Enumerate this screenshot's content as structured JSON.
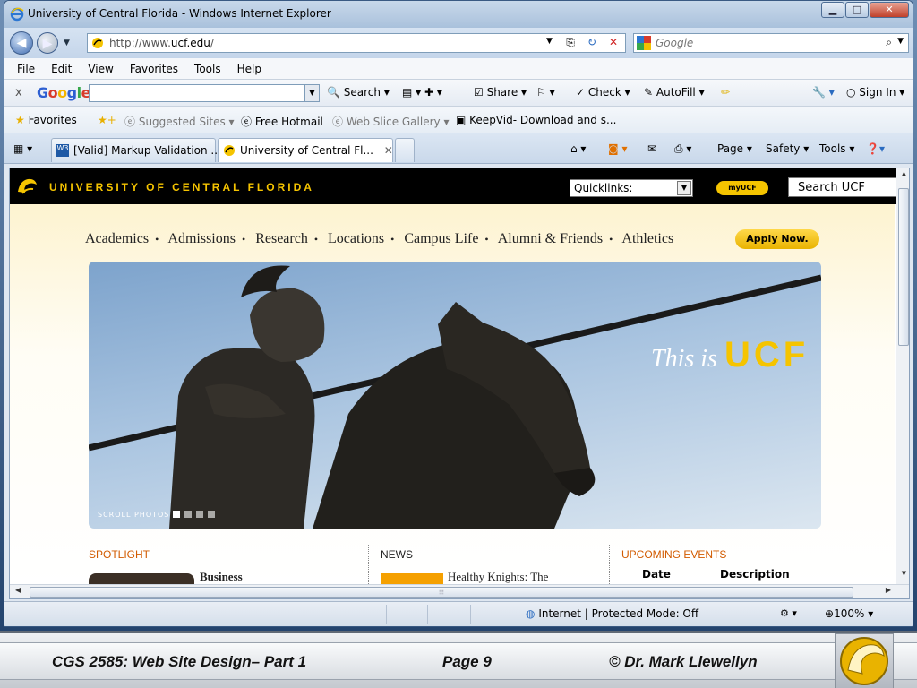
{
  "window": {
    "title": "University of Central Florida - Windows Internet Explorer",
    "minimize": "▁",
    "maximize": "□",
    "close": "✕"
  },
  "address_bar": {
    "url_prefix": "http://www.",
    "url_domain": "ucf.edu",
    "url_suffix": "/",
    "search_placeholder": "Google"
  },
  "menu": [
    "File",
    "Edit",
    "View",
    "Favorites",
    "Tools",
    "Help"
  ],
  "google_toolbar": {
    "close": "x",
    "logo": "Google",
    "search_label": "Search",
    "share_label": "Share",
    "check_label": "Check",
    "autofill_label": "AutoFill",
    "signin_label": "Sign In"
  },
  "favorites_bar": {
    "favorites": "Favorites",
    "suggested": "Suggested Sites",
    "hotmail": "Free Hotmail",
    "slice": "Web Slice Gallery",
    "keepvid": "KeepVid- Download and s..."
  },
  "tabs": [
    {
      "label": "[Valid] Markup Validation ..."
    },
    {
      "label": "University of Central Fl..."
    }
  ],
  "command_bar": {
    "page": "Page",
    "safety": "Safety",
    "tools": "Tools"
  },
  "site": {
    "name": "UNIVERSITY OF CENTRAL FLORIDA",
    "quicklinks": "Quicklinks:",
    "myucf": "myUCF",
    "search_placeholder": "Search UCF",
    "nav": [
      "Academics",
      "Admissions",
      "Research",
      "Locations",
      "Campus Life",
      "Alumni & Friends",
      "Athletics"
    ],
    "apply": "Apply Now.",
    "hero_this": "This is",
    "hero_ucf": "UCF",
    "scroll_photos": "SCROLL PHOTOS",
    "spotlight": "SPOTLIGHT",
    "spotlight_item": "Business",
    "news": "NEWS",
    "news_item": "Healthy Knights: The",
    "events": "UPCOMING EVENTS",
    "events_date": "Date",
    "events_desc": "Description"
  },
  "status_bar": {
    "zone": "Internet | Protected Mode: Off",
    "zoom": "100%"
  },
  "slide_footer": {
    "course": "CGS 2585: Web Site Design– Part 1",
    "page": "Page 9",
    "author": "© Dr. Mark Llewellyn"
  },
  "colors": {
    "ucf_gold": "#f5c400",
    "spotlight_orange": "#d25b00",
    "ucf_black": "#000000"
  }
}
